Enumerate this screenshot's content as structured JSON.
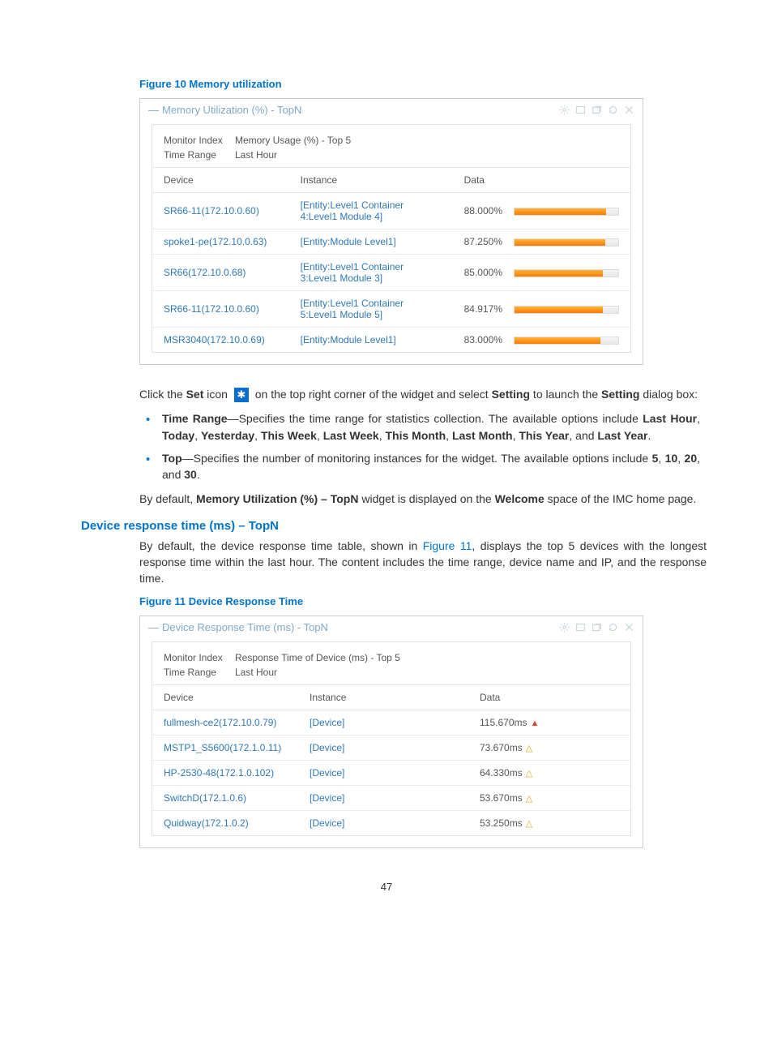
{
  "figure10": {
    "caption": "Figure 10 Memory utilization",
    "widgetTitle": "Memory Utilization (%) - TopN",
    "meta": {
      "indexLabel": "Monitor Index",
      "indexValue": "Memory Usage (%) - Top 5",
      "rangeLabel": "Time Range",
      "rangeValue": "Last Hour"
    },
    "columns": {
      "c1": "Device",
      "c2": "Instance",
      "c3": "Data"
    },
    "rows": [
      {
        "device": "SR66-11(172.10.0.60)",
        "instance": "[Entity:Level1 Container 4:Level1 Module 4]",
        "value": "88.000%",
        "pct": 88
      },
      {
        "device": "spoke1-pe(172.10.0.63)",
        "instance": "[Entity:Module Level1]",
        "value": "87.250%",
        "pct": 87.25
      },
      {
        "device": "SR66(172.10.0.68)",
        "instance": "[Entity:Level1 Container 3:Level1 Module 3]",
        "value": "85.000%",
        "pct": 85
      },
      {
        "device": "SR66-11(172.10.0.60)",
        "instance": "[Entity:Level1 Container 5:Level1 Module 5]",
        "value": "84.917%",
        "pct": 84.917
      },
      {
        "device": "MSR3040(172.10.0.69)",
        "instance": "[Entity:Module Level1]",
        "value": "83.000%",
        "pct": 83
      }
    ]
  },
  "prose": {
    "setIconSentence_pre": "Click the ",
    "setIconSentence_set": "Set",
    "setIconSentence_mid": " icon ",
    "setIconSentence_post1": " on the top right corner of the widget and select ",
    "setIconSentence_setting": "Setting",
    "setIconSentence_post2": " to launch the ",
    "setIconSentence_post3": " dialog box:",
    "bullet1_head": "Time Range",
    "bullet1_body": "—Specifies the time range for statistics collection. The available options include ",
    "bullet1_opts": [
      "Last Hour",
      "Today",
      "Yesterday",
      "This Week",
      "Last Week",
      "This Month",
      "Last Month",
      "This Year",
      "Last Year"
    ],
    "bullet2_head": "Top",
    "bullet2_body": "—Specifies the number of monitoring instances for the widget. The available options include ",
    "bullet2_opts": [
      "5",
      "10",
      "20",
      "30"
    ],
    "defaultPara_p1": "By default, ",
    "defaultPara_b1": "Memory Utilization (%) – TopN",
    "defaultPara_p2": " widget is displayed on the ",
    "defaultPara_b2": "Welcome",
    "defaultPara_p3": " space of the IMC home page."
  },
  "section2": {
    "heading": "Device response time (ms) – TopN",
    "intro_p1": "By default, the device response time table, shown in ",
    "intro_link": "Figure 11",
    "intro_p2": ", displays the top 5 devices with the longest response time within the last hour. The content includes the time range, device name and IP, and the response time."
  },
  "figure11": {
    "caption": "Figure 11 Device Response Time",
    "widgetTitle": "Device Response Time (ms) - TopN",
    "meta": {
      "indexLabel": "Monitor Index",
      "indexValue": "Response Time of Device (ms) - Top 5",
      "rangeLabel": "Time Range",
      "rangeValue": "Last Hour"
    },
    "columns": {
      "c1": "Device",
      "c2": "Instance",
      "c3": "Data"
    },
    "rows": [
      {
        "device": "fullmesh-ce2(172.10.0.79)",
        "instance": "[Device]",
        "value": "115.670ms",
        "trend": "up"
      },
      {
        "device": "MSTP1_S5600(172.1.0.11)",
        "instance": "[Device]",
        "value": "73.670ms",
        "trend": "same"
      },
      {
        "device": "HP-2530-48(172.1.0.102)",
        "instance": "[Device]",
        "value": "64.330ms",
        "trend": "same"
      },
      {
        "device": "SwitchD(172.1.0.6)",
        "instance": "[Device]",
        "value": "53.670ms",
        "trend": "same"
      },
      {
        "device": "Quidway(172.1.0.2)",
        "instance": "[Device]",
        "value": "53.250ms",
        "trend": "same"
      }
    ]
  },
  "labels": {
    "and": "and"
  },
  "page": "47",
  "chart_data": {
    "type": "bar",
    "title": "Memory Usage (%) - Top 5",
    "categories": [
      "SR66-11(172.10.0.60)",
      "spoke1-pe(172.10.0.63)",
      "SR66(172.10.0.68)",
      "SR66-11(172.10.0.60)",
      "MSR3040(172.10.0.69)"
    ],
    "values": [
      88.0,
      87.25,
      85.0,
      84.917,
      83.0
    ],
    "ylabel": "Memory Usage (%)",
    "ylim": [
      0,
      100
    ]
  }
}
